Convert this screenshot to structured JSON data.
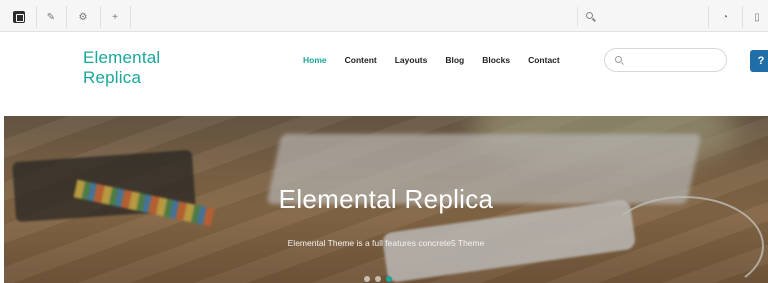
{
  "toolbar": {
    "buttons": [
      {
        "name": "menu-icon"
      },
      {
        "name": "edit-icon"
      },
      {
        "name": "settings-icon"
      },
      {
        "name": "add-icon"
      }
    ],
    "search_icon": "search-icon",
    "right_icons": [
      "info-icon",
      "panel-icon"
    ]
  },
  "site": {
    "brand_line1": "Elemental",
    "brand_line2": "Replica",
    "nav": [
      {
        "label": "Home",
        "active": true
      },
      {
        "label": "Content",
        "active": false
      },
      {
        "label": "Layouts",
        "active": false
      },
      {
        "label": "Blog",
        "active": false
      },
      {
        "label": "Blocks",
        "active": false
      },
      {
        "label": "Contact",
        "active": false
      }
    ],
    "search_placeholder": "",
    "help_label": "?"
  },
  "hero": {
    "title": "Elemental Replica",
    "subtitle": "Elemental Theme is a full features concrete5 Theme"
  },
  "colors": {
    "accent": "#1aa79b",
    "help_button": "#1f6ea8"
  }
}
